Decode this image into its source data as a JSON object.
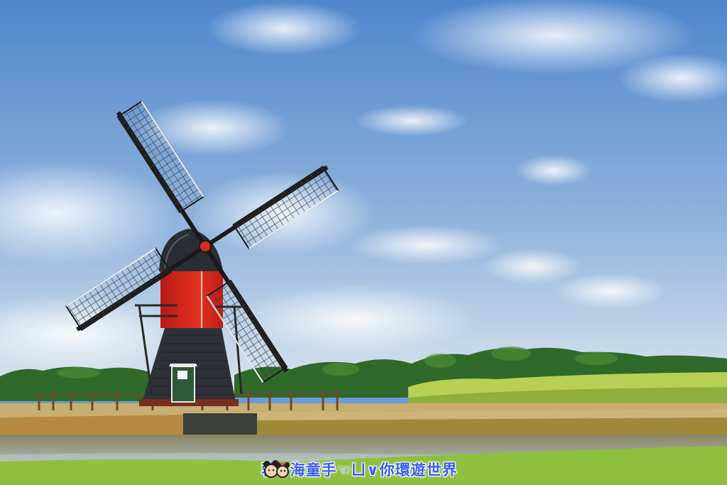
{
  "photo": {
    "subject": "windmill",
    "colors": {
      "sky_top": "#4f86cc",
      "sky_bottom": "#c6d8ea",
      "mill_body": "#d92a1e",
      "mill_base": "#2e3238",
      "door": "#2f5a3a",
      "grass": "#8fbf3e",
      "trees": "#2f6a2a",
      "water": "#7a7a5a"
    }
  },
  "watermark": {
    "text": "蓉❤海童手☜ㄩ∨你環遊世界",
    "mascot_icon": "mickey-minnie-icon"
  }
}
